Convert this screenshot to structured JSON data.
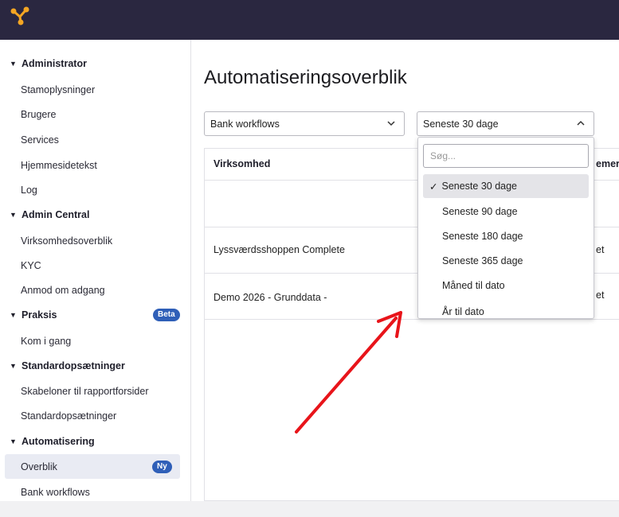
{
  "sidebar": {
    "groups": [
      {
        "label": "Administrator",
        "items": [
          "Stamoplysninger",
          "Brugere",
          "Services",
          "Hjemmesidetekst",
          "Log"
        ]
      },
      {
        "label": "Admin Central",
        "items": [
          "Virksomhedsoverblik",
          "KYC",
          "Anmod om adgang"
        ]
      },
      {
        "label": "Praksis",
        "badge": "Beta",
        "items": [
          "Kom i gang"
        ]
      },
      {
        "label": "Standardopsætninger",
        "items": [
          "Skabeloner til rapportforsider",
          "Standardopsætninger"
        ]
      },
      {
        "label": "Automatisering",
        "items": [
          "Overblik",
          "Bank workflows"
        ]
      }
    ],
    "active_badge": "Ny",
    "expand_icon": "▼"
  },
  "main": {
    "title": "Automatiseringsoverblik",
    "filter_workflow": "Bank workflows",
    "filter_period": "Seneste 30 dage",
    "columns": [
      "Virksomhed",
      "emer"
    ],
    "rows": [
      {
        "company": "Lyssværdsshoppen Complete",
        "status": "et"
      },
      {
        "company": "Demo 2026 - Grunddata -",
        "status": "et"
      }
    ]
  },
  "dropdown": {
    "search_placeholder": "Søg...",
    "check": "✓",
    "options": [
      "Seneste 30 dage",
      "Seneste 90 dage",
      "Seneste 180 dage",
      "Seneste 365 dage",
      "Måned til dato",
      "År til dato"
    ],
    "selected_index": 0
  },
  "colors": {
    "topbar": "#2a2740",
    "badge": "#2f5fb8",
    "annotation_arrow": "#e8141a",
    "logo": "#f5a623"
  }
}
